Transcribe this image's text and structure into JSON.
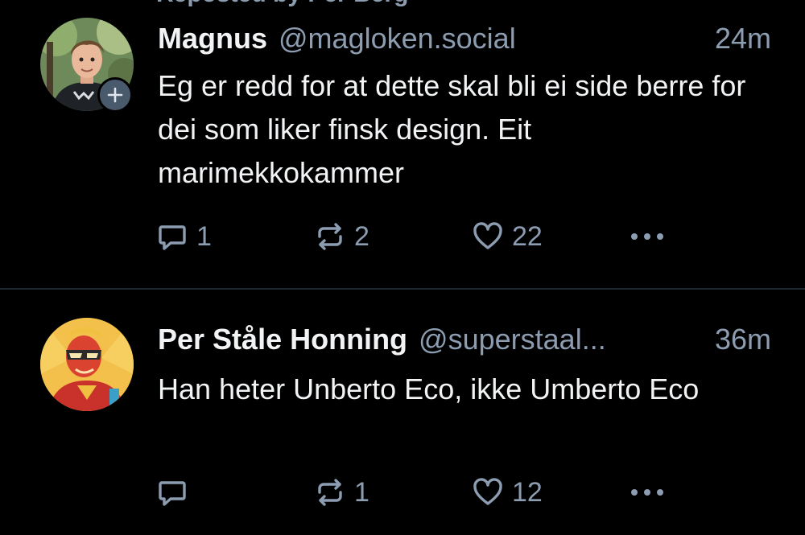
{
  "repost_banner": {
    "label": "Reposted by Per Berg",
    "icon": "repost-icon"
  },
  "posts": [
    {
      "author": {
        "display_name": "Magnus",
        "handle": "@magloken.social",
        "avatar": "avatar-magnus",
        "follow_badge_icon": "plus-icon"
      },
      "timestamp": "24m",
      "text": "Eg er redd for at dette skal bli ei side berre for dei som liker finsk design. Eit marimekkokammer",
      "actions": {
        "reply_count": "1",
        "repost_count": "2",
        "like_count": "22",
        "reply_icon": "reply-icon",
        "repost_icon": "repost-icon",
        "like_icon": "heart-icon",
        "more_icon": "more-icon"
      }
    },
    {
      "author": {
        "display_name": "Per Ståle Honning",
        "handle": "@superstaal...",
        "avatar": "avatar-per-stale"
      },
      "timestamp": "36m",
      "text": "Han heter Unberto Eco, ikke Umberto Eco",
      "actions": {
        "reply_count": "",
        "repost_count": "1",
        "like_count": "12",
        "reply_icon": "reply-icon",
        "repost_icon": "repost-icon",
        "like_icon": "heart-icon",
        "more_icon": "more-icon"
      }
    }
  ],
  "colors": {
    "background": "#000000",
    "text": "#f1f3f5",
    "muted": "#8d9db1",
    "divider": "#1e2833",
    "badge": "#4a5a6d"
  }
}
